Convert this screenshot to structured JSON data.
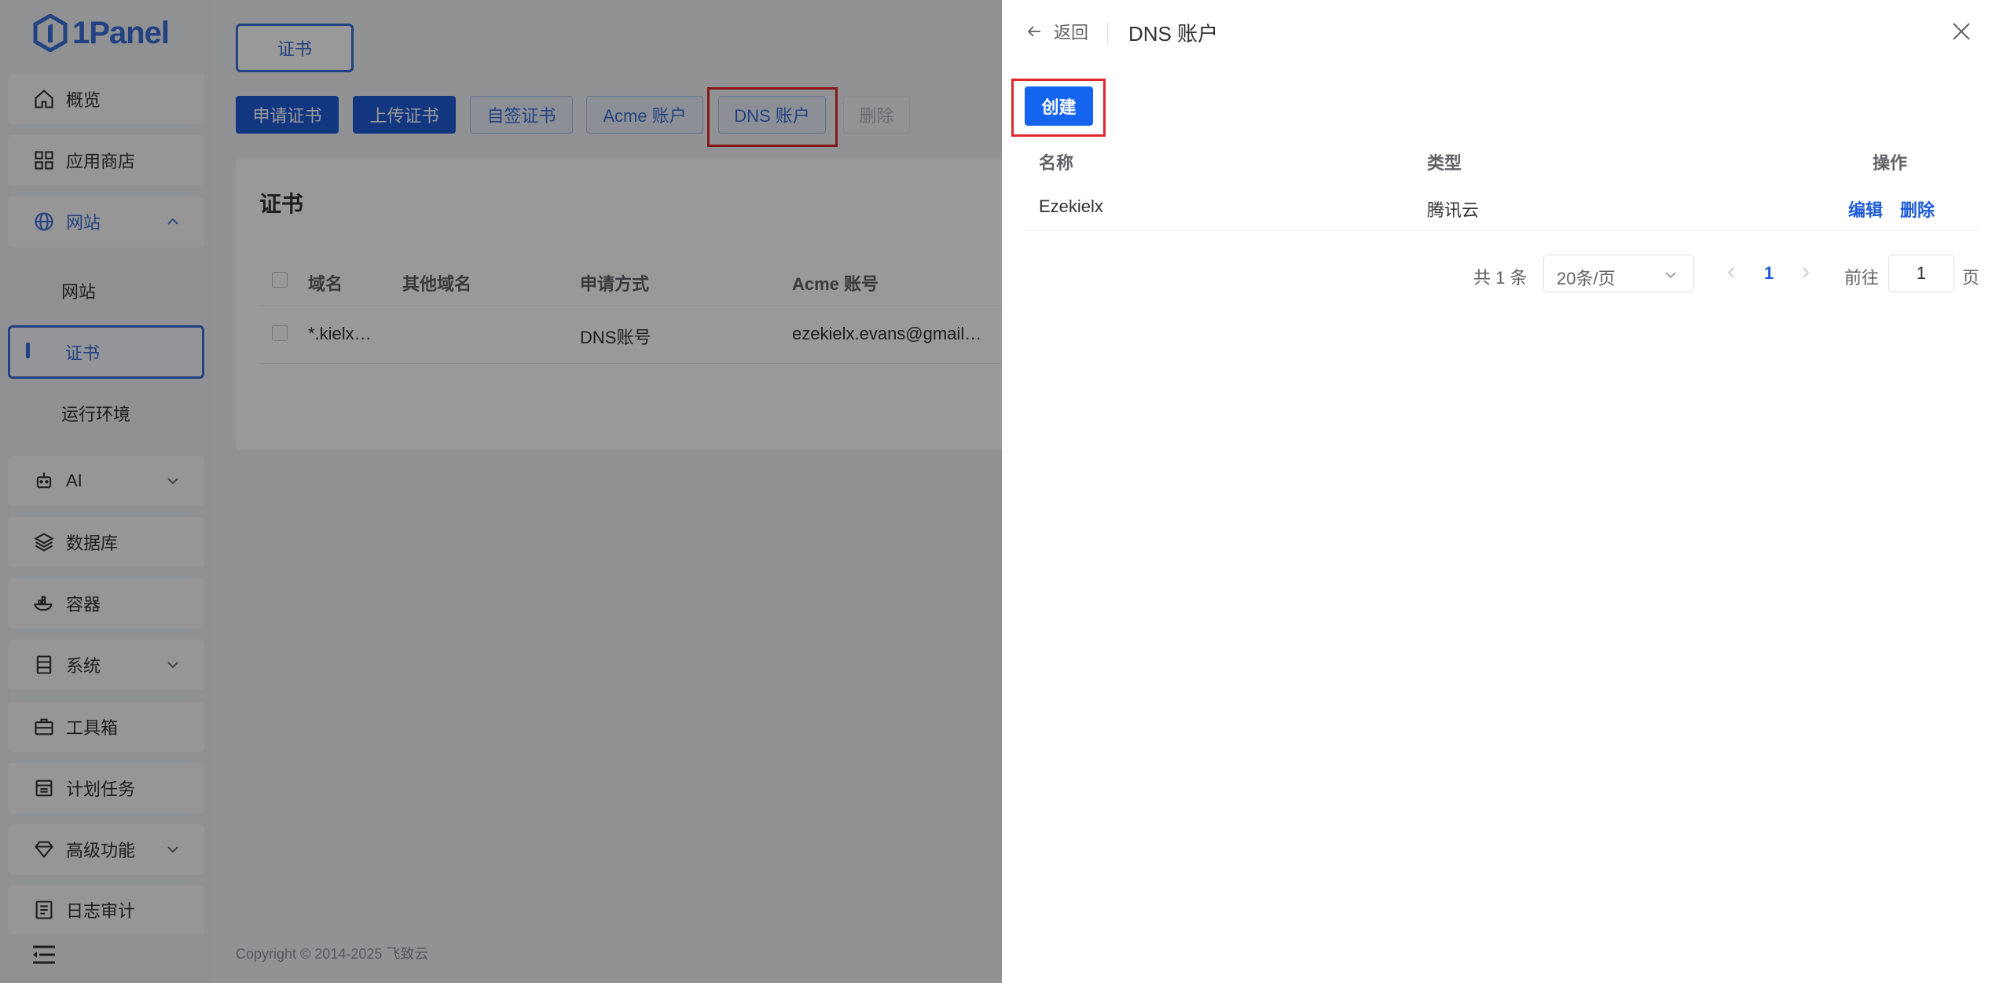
{
  "app": {
    "logo_text": "1Panel"
  },
  "sidebar": {
    "items": [
      {
        "label": "概览",
        "icon": "home-icon"
      },
      {
        "label": "应用商店",
        "icon": "grid-icon"
      },
      {
        "label": "网站",
        "icon": "globe-icon",
        "expanded": true
      },
      {
        "label": "AI",
        "icon": "robot-icon"
      },
      {
        "label": "数据库",
        "icon": "layers-icon"
      },
      {
        "label": "容器",
        "icon": "container-icon"
      },
      {
        "label": "系统",
        "icon": "server-icon"
      },
      {
        "label": "工具箱",
        "icon": "toolbox-icon"
      },
      {
        "label": "计划任务",
        "icon": "calendar-icon"
      },
      {
        "label": "高级功能",
        "icon": "diamond-icon"
      },
      {
        "label": "日志审计",
        "icon": "log-icon"
      }
    ],
    "sub_items": [
      "网站",
      "证书",
      "运行环境"
    ],
    "active_sub": "证书",
    "collapse_icon": "menu-collapse-icon"
  },
  "main": {
    "tab": "证书",
    "toolbar": {
      "apply": "申请证书",
      "upload": "上传证书",
      "self_signed": "自签证书",
      "acme": "Acme 账户",
      "dns": "DNS 账户",
      "delete": "删除"
    },
    "card_title": "证书",
    "table": {
      "headers": [
        "域名",
        "其他域名",
        "申请方式",
        "Acme 账号"
      ],
      "rows": [
        {
          "domain": "*.kielx…",
          "other": "",
          "method": "DNS账号",
          "acme": "ezekielx.evans@gmail…"
        }
      ]
    },
    "footer": "Copyright © 2014-2025 飞致云"
  },
  "drawer": {
    "back_label": "返回",
    "title": "DNS 账户",
    "create_label": "创建",
    "table": {
      "headers": [
        "名称",
        "类型",
        "操作"
      ],
      "rows": [
        {
          "name": "Ezekielx",
          "type": "腾讯云",
          "edit": "编辑",
          "delete": "删除"
        }
      ]
    },
    "pagination": {
      "total_label": "共 1 条",
      "page_size": "20条/页",
      "current_page": "1",
      "goto_label": "前往",
      "goto_value": "1",
      "page_suffix": "页"
    }
  },
  "colors": {
    "accent": "#1f5cd6",
    "highlight": "#e0272c"
  }
}
